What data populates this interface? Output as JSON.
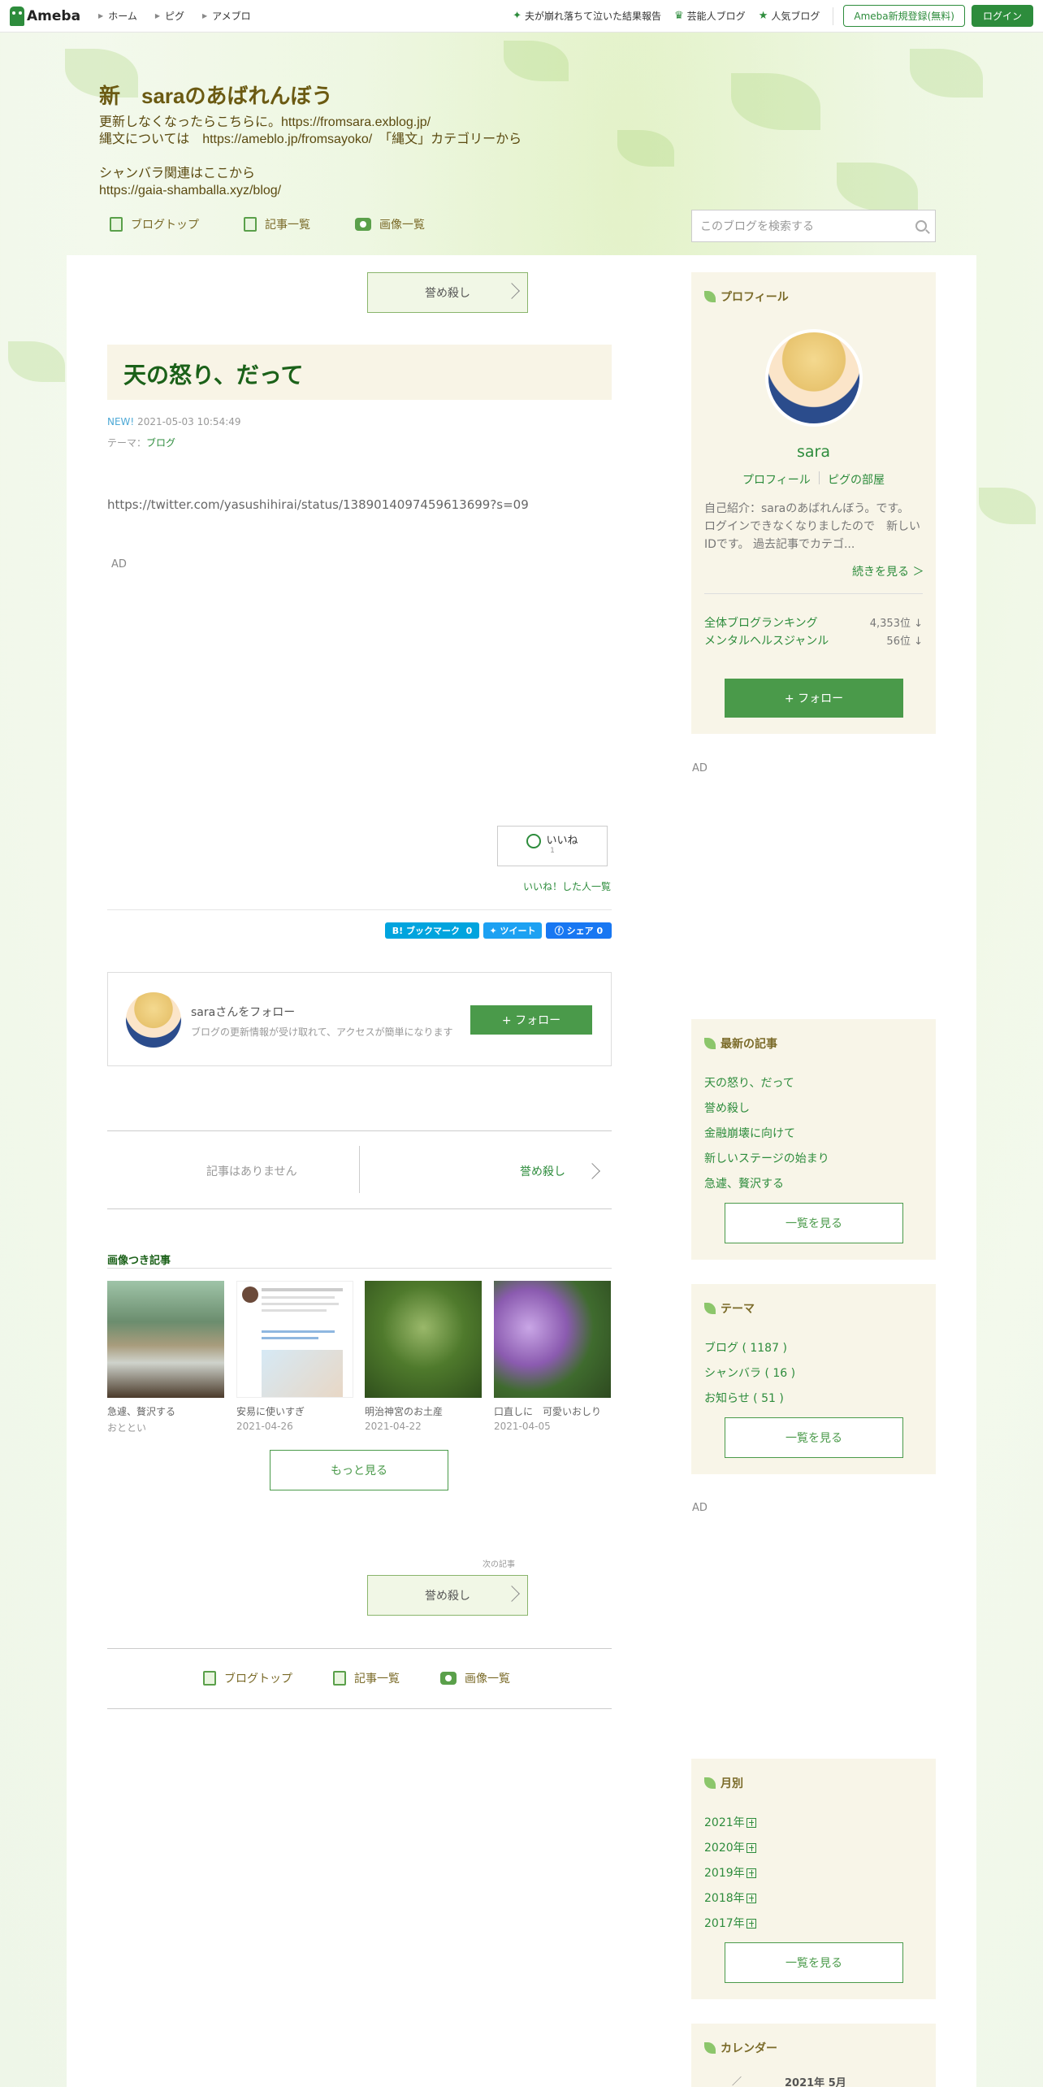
{
  "topbar": {
    "logo": "Ameba",
    "nav": [
      "ホーム",
      "ピグ",
      "アメブロ"
    ],
    "links": [
      "夫が崩れ落ちて泣いた結果報告",
      "芸能人ブログ",
      "人気ブログ"
    ],
    "register": "Ameba新規登録(無料)",
    "login": "ログイン"
  },
  "header": {
    "title": "新　saraのあばれんぼう",
    "description": "更新しなくなったらこちらに。https://fromsara.exblog.jp/\n縄文については　https://ameblo.jp/fromsayoko/　「縄文」カテゴリーから\n\nシャンバラ関連はここから\nhttps://gaia-shamballa.xyz/blog/",
    "nav": [
      "ブログトップ",
      "記事一覧",
      "画像一覧"
    ],
    "search_placeholder": "このブログを検索する"
  },
  "article": {
    "next_top": "誉め殺し",
    "title": "天の怒り、だって",
    "new_label": "NEW!",
    "date": "2021-05-03 10:54:49",
    "theme_label": "テーマ：",
    "theme": "ブログ",
    "body": "https://twitter.com/yasushihirai/status/1389014097459613699?s=09",
    "ad": "AD",
    "like_label": "いいね",
    "like_count": "1",
    "liked_list": "いいね！した人一覧",
    "share": {
      "hatena": "B! ブックマーク",
      "hatena_count": "0",
      "tweet": "ツイート",
      "fb": "シェア",
      "fb_count": "0"
    }
  },
  "follow": {
    "name": "saraさんをフォロー",
    "desc": "ブログの更新情報が受け取れて、アクセスが簡単になります",
    "button": "+ フォロー"
  },
  "pager": {
    "prev": "記事はありません",
    "next": "誉め殺し"
  },
  "image_articles": {
    "heading": "画像つき記事",
    "items": [
      {
        "title": "急遽、贅沢する",
        "sub": "おととい"
      },
      {
        "title": "安易に使いすぎ",
        "sub": "2021-04-26"
      },
      {
        "title": "明治神宮のお土産",
        "sub": "2021-04-22"
      },
      {
        "title": "口直しに　可愛いおしり",
        "sub": "2021-04-05"
      }
    ],
    "more": "もっと見る"
  },
  "bottom": {
    "next_label": "次の記事",
    "next_title": "誉め殺し",
    "nav": [
      "ブログトップ",
      "記事一覧",
      "画像一覧"
    ]
  },
  "sidebar": {
    "profile": {
      "heading": "プロフィール",
      "name": "sara",
      "links": [
        "プロフィール",
        "ピグの部屋"
      ],
      "intro": "自己紹介：saraのあばれんぼう。です。 ログインできなくなりましたので　新しいIDです。 過去記事でカテゴ...",
      "more": "続きを見る ＞",
      "rankings": [
        {
          "label": "全体ブログランキング",
          "value": "4,353位 ↓"
        },
        {
          "label": "メンタルヘルスジャンル",
          "value": "56位 ↓"
        }
      ],
      "follow": "+ フォロー"
    },
    "ad1": "AD",
    "recent": {
      "heading": "最新の記事",
      "items": [
        "天の怒り、だって",
        "誉め殺し",
        "金融崩壊に向けて",
        "新しいステージの始まり",
        "急遽、贅沢する"
      ],
      "button": "一覧を見る"
    },
    "themes": {
      "heading": "テーマ",
      "items": [
        "ブログ ( 1187 )",
        "シャンバラ ( 16 )",
        "お知らせ ( 51 )"
      ],
      "button": "一覧を見る"
    },
    "ad2": "AD",
    "monthly": {
      "heading": "月別",
      "items": [
        "2021年",
        "2020年",
        "2019年",
        "2018年",
        "2017年"
      ],
      "button": "一覧を見る"
    },
    "calendar": {
      "heading": "カレンダー",
      "month": "2021年 5月"
    }
  },
  "colors": {
    "accent": "#2d8c3c",
    "title_green": "#1b6119",
    "header_text": "#6b5a12",
    "sidebar_bg": "#f8f5e8"
  }
}
